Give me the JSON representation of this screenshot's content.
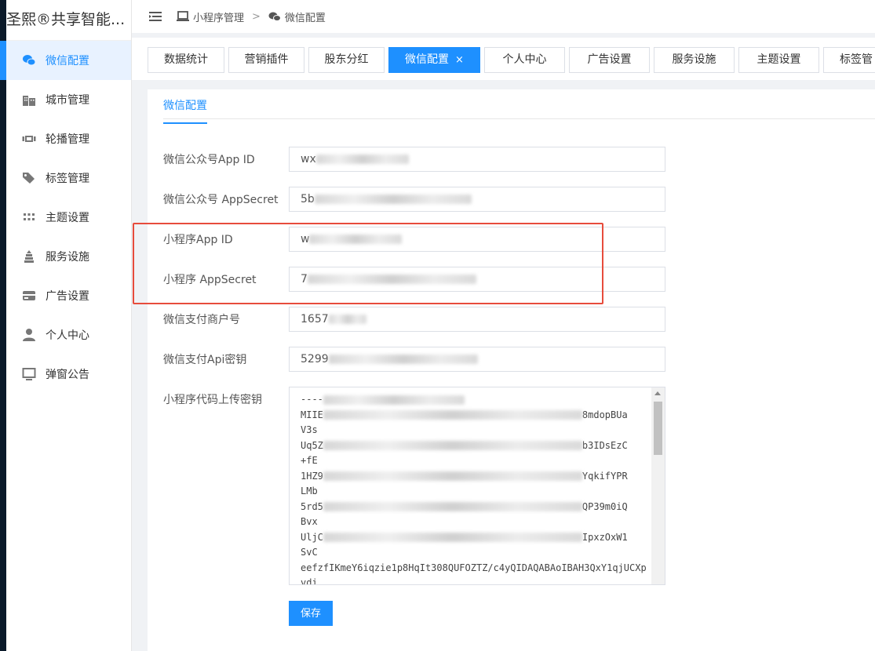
{
  "brand": "圣熙®共享智能...",
  "sidebar": {
    "items": [
      {
        "label": "微信配置",
        "icon": "wechat-chat-icon"
      },
      {
        "label": "城市管理",
        "icon": "building-icon"
      },
      {
        "label": "轮播管理",
        "icon": "carousel-icon"
      },
      {
        "label": "标签管理",
        "icon": "tag-icon"
      },
      {
        "label": "主题设置",
        "icon": "grid-icon"
      },
      {
        "label": "服务设施",
        "icon": "facility-icon"
      },
      {
        "label": "广告设置",
        "icon": "card-icon"
      },
      {
        "label": "个人中心",
        "icon": "user-icon"
      },
      {
        "label": "弹窗公告",
        "icon": "monitor-icon"
      }
    ]
  },
  "breadcrumb": {
    "parent": "小程序管理",
    "current": "微信配置"
  },
  "tabs": [
    {
      "label": "数据统计"
    },
    {
      "label": "营销插件"
    },
    {
      "label": "股东分红"
    },
    {
      "label": "微信配置",
      "closable": "×"
    },
    {
      "label": "个人中心"
    },
    {
      "label": "广告设置"
    },
    {
      "label": "服务设施"
    },
    {
      "label": "主题设置"
    },
    {
      "label": "标签管"
    }
  ],
  "subtab": "微信配置",
  "form": {
    "mp_appid": {
      "label": "微信公众号App ID",
      "prefix": "wx"
    },
    "mp_secret": {
      "label": "微信公众号 AppSecret",
      "prefix": "5b"
    },
    "mini_appid": {
      "label": "小程序App ID",
      "prefix": "w"
    },
    "mini_secret": {
      "label": "小程序 AppSecret",
      "prefix": "7"
    },
    "mch_id": {
      "label": "微信支付商户号",
      "prefix": "1657"
    },
    "api_key": {
      "label": "微信支付Api密钥",
      "prefix": "5299"
    },
    "upload_key": {
      "label": "小程序代码上传密钥",
      "lines": [
        {
          "pre": "----",
          "post": ""
        },
        {
          "pre": "MIIE",
          "post": "8mdopBUa"
        },
        {
          "pre": "V3s",
          "post": ""
        },
        {
          "pre": "Uq5Z",
          "post": "b3IDsEzC"
        },
        {
          "pre": "+fE",
          "post": ""
        },
        {
          "pre": "1HZ9",
          "post": "YqkifYPR"
        },
        {
          "pre": "LMb",
          "post": ""
        },
        {
          "pre": "5rd5",
          "post": "QP39m0iQ"
        },
        {
          "pre": "Bvx",
          "post": ""
        },
        {
          "pre": "UljC",
          "post": "IpxzOxW1"
        },
        {
          "pre": "SvC",
          "post": ""
        },
        {
          "pre": "eefzfIKmeY6iqzie1p8HqIt308QUFOZTZ/c4yQIDAQABAoIBAH3QxY1qjUCXp",
          "post": ""
        },
        {
          "pre": "vdi",
          "post": ""
        }
      ]
    }
  },
  "save_label": "保存",
  "colors": {
    "accent": "#1e90ff",
    "highlight_box": "#e74c3c"
  }
}
